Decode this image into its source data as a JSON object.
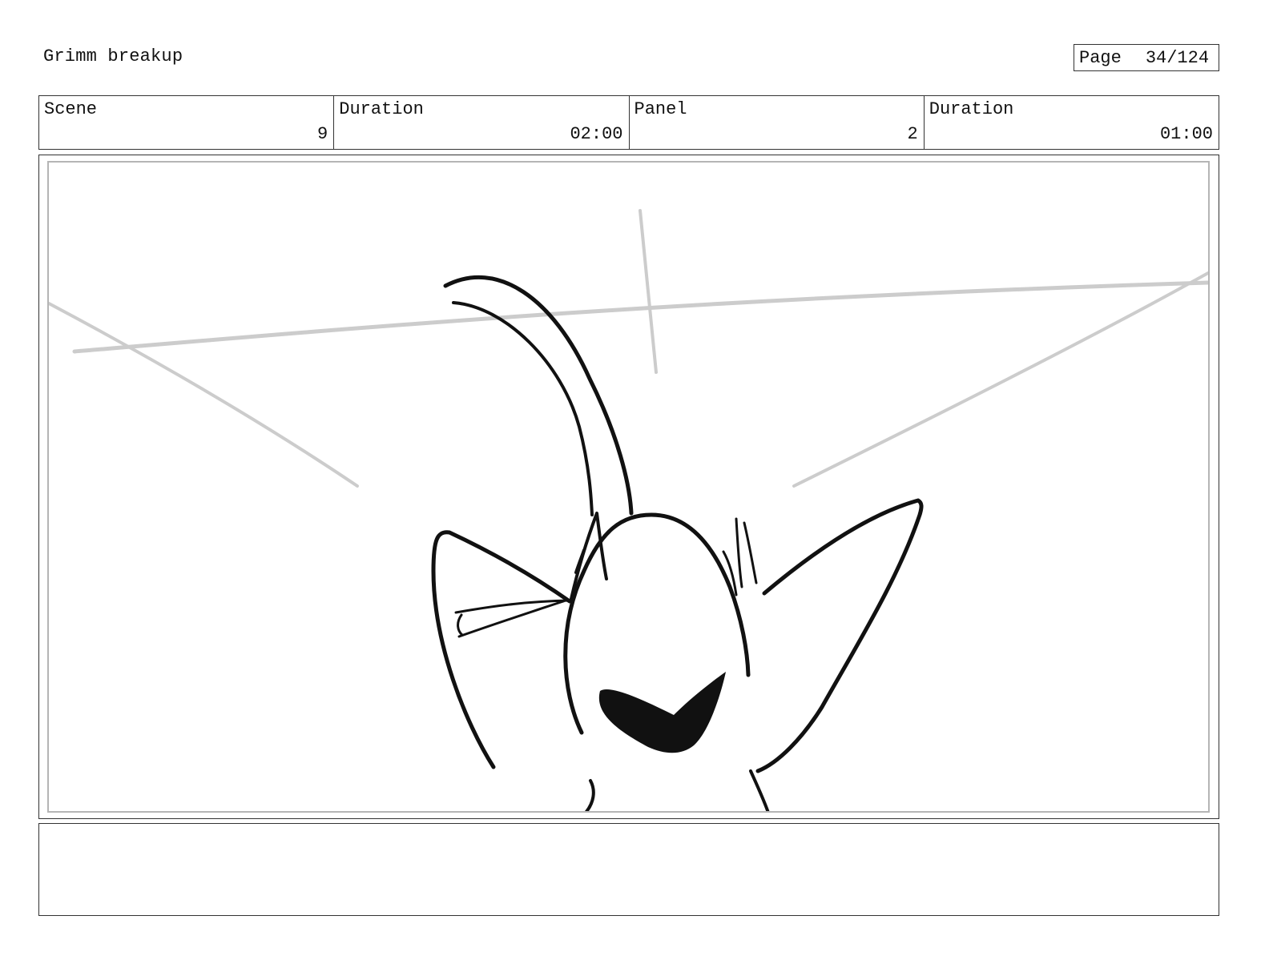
{
  "header": {
    "project_title": "Grimm breakup",
    "page_label": "Page",
    "page_number": "34/124"
  },
  "fields": [
    {
      "label": "Scene",
      "value": "9"
    },
    {
      "label": "Duration",
      "value": "02:00"
    },
    {
      "label": "Panel",
      "value": "2"
    },
    {
      "label": "Duration",
      "value": "01:00"
    }
  ],
  "panel": {
    "sketch": "character-head-sketch",
    "guide_line_color": "#cccccc",
    "ink_color": "#111111"
  },
  "notes": {
    "text": ""
  }
}
